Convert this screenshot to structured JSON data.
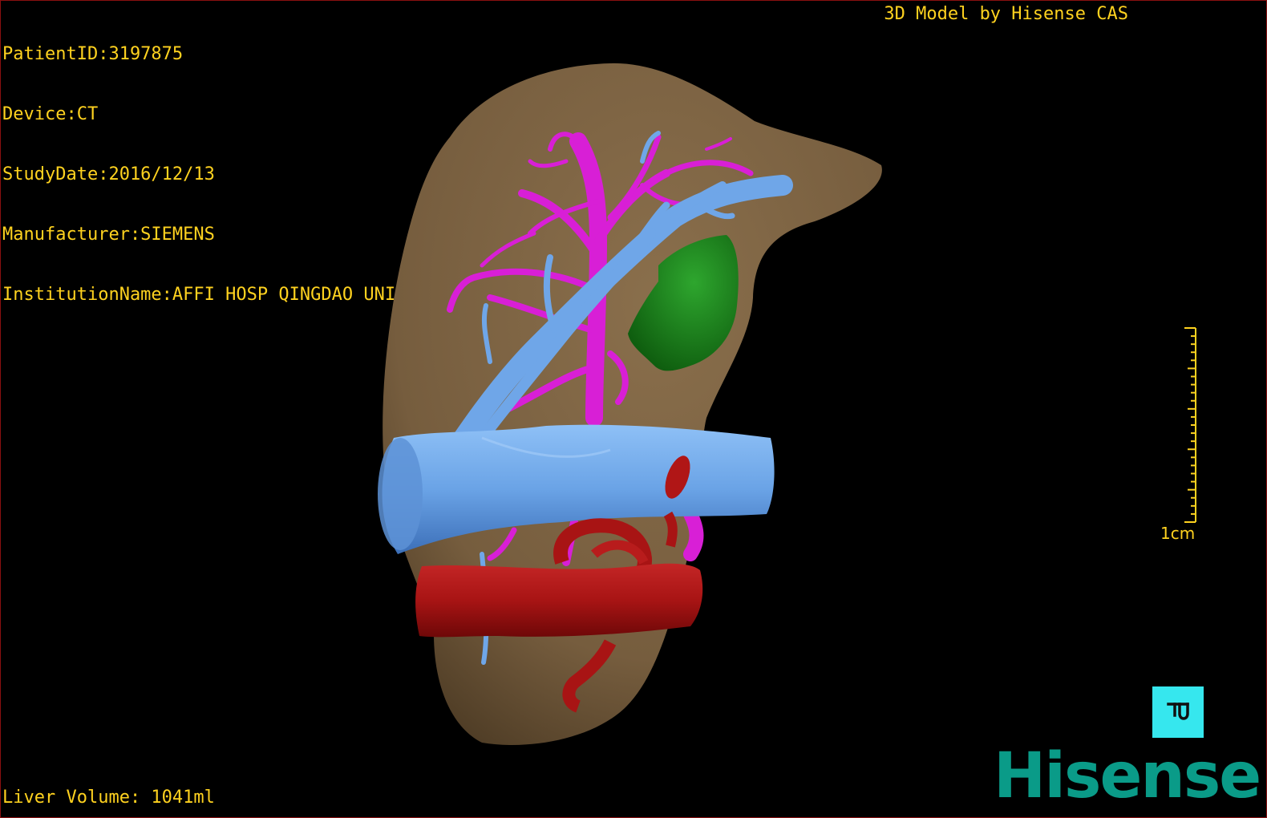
{
  "patient_info": {
    "patient_id": "PatientID:3197875",
    "device": "Device:CT",
    "study_date": "StudyDate:2016/12/13",
    "manufacturer": "Manufacturer:SIEMENS",
    "institution": "InstitutionName:AFFI HOSP QINGDAO UNI"
  },
  "credit": "3D Model by Hisense CAS",
  "liver_volume": "Liver Volume: 1041ml",
  "scale_bar": {
    "label": "1cm"
  },
  "orientation_button": {
    "icon": "orientation-cube-icon"
  },
  "brand": "Hisense",
  "colors": {
    "overlay_text": "#ffd21f",
    "liver": "#7d6443",
    "portal_vein": "#6fa6e8",
    "hepatic_vein": "#d81fd6",
    "artery": "#b21818",
    "tumor": "#1f8a1f",
    "orientation_button": "#36e7ee",
    "brand": "#0a9b88"
  }
}
